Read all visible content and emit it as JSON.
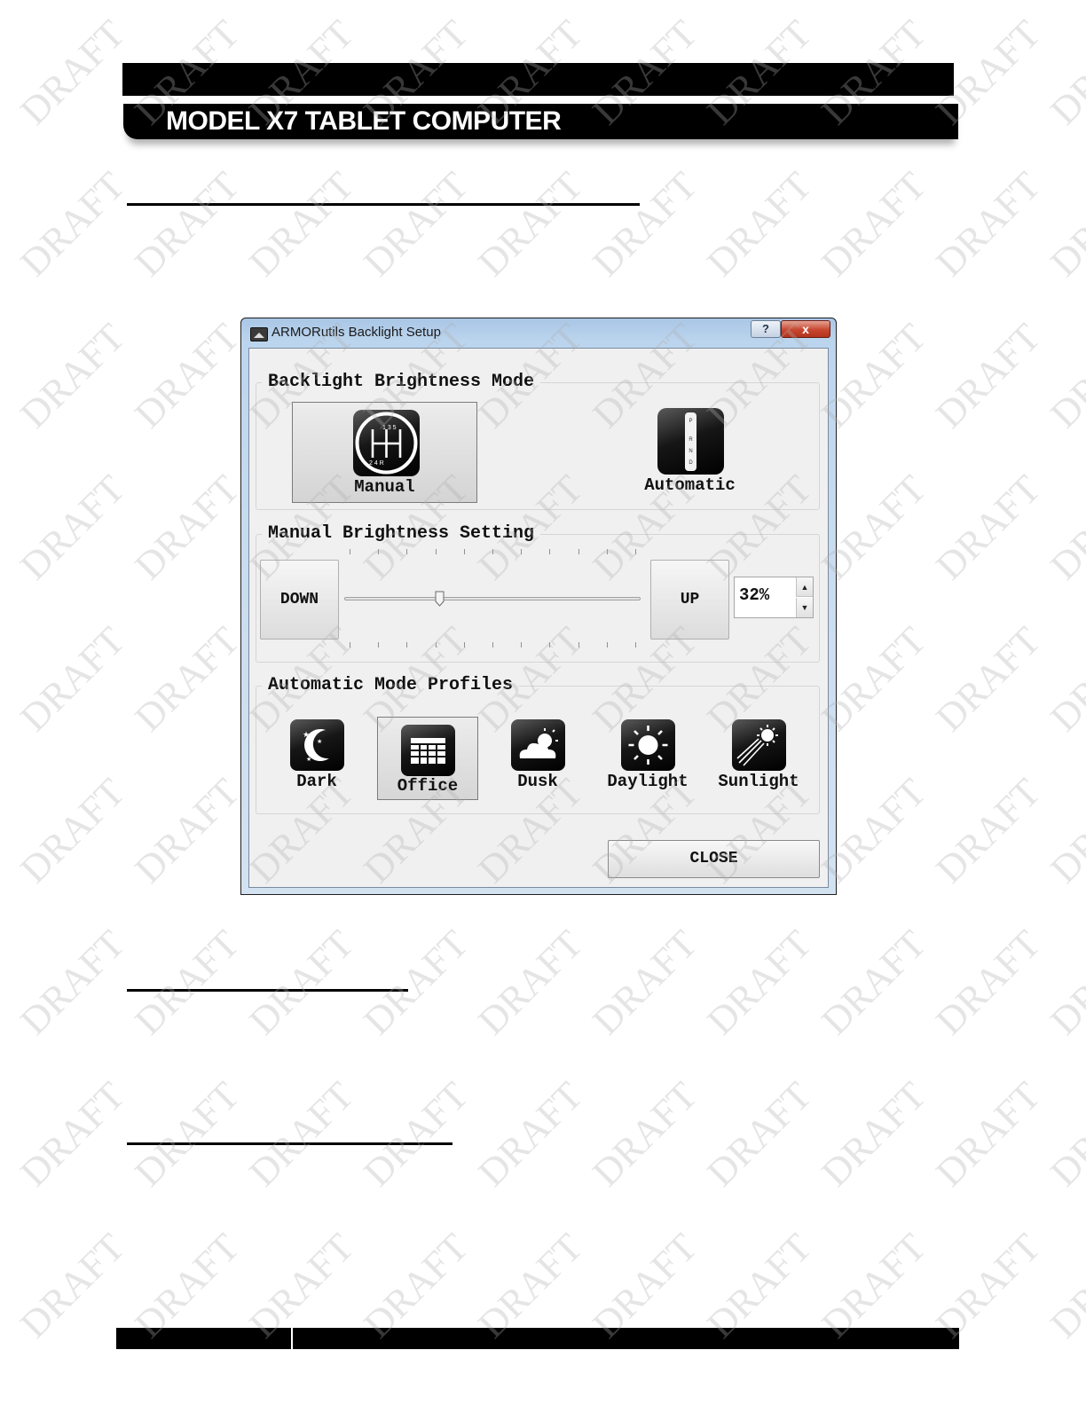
{
  "document": {
    "header_title": "MODEL X7 TABLET COMPUTER",
    "watermark": "DRAFT"
  },
  "dialog": {
    "title": "ARMORutils Backlight Setup",
    "help_label": "?",
    "close_glyph": "x",
    "brightness_mode": {
      "legend": "Backlight Brightness Mode",
      "options": [
        {
          "label": "Manual",
          "icon": "gear-shift-icon",
          "selected": true
        },
        {
          "label": "Automatic",
          "icon": "automatic-shifter-icon",
          "selected": false
        }
      ],
      "shifter_letters": [
        "P",
        "R",
        "N",
        "D"
      ]
    },
    "manual_setting": {
      "legend": "Manual Brightness Setting",
      "down_label": "DOWN",
      "up_label": "UP",
      "value_text": "32%",
      "value_percent": 32
    },
    "profiles": {
      "legend": "Automatic Mode Profiles",
      "items": [
        {
          "label": "Dark",
          "icon": "moon-stars-icon",
          "selected": false
        },
        {
          "label": "Office",
          "icon": "office-building-icon",
          "selected": true
        },
        {
          "label": "Dusk",
          "icon": "cloud-sun-icon",
          "selected": false
        },
        {
          "label": "Daylight",
          "icon": "sun-icon",
          "selected": false
        },
        {
          "label": "Sunlight",
          "icon": "sun-rays-icon",
          "selected": false
        }
      ]
    },
    "close_label": "CLOSE"
  }
}
